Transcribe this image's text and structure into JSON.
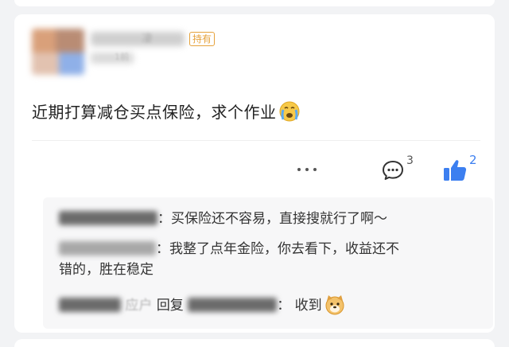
{
  "post": {
    "holding_badge": "持有",
    "text": "近期打算减仓买点保险，求个作业",
    "emoji": "crying-face",
    "username_visible_fragment": "凄",
    "subline_visible_fragment": "1前"
  },
  "actions": {
    "comment_count": "3",
    "like_count": "2"
  },
  "replies": [
    {
      "text": "：买保险还不容易，直接搜就行了啊～"
    },
    {
      "line1": "：我整了点年金险，你去看下，收益还不",
      "line2": "错的，胜在稳定"
    },
    {
      "name_fragment": "应户",
      "reply_word": "回复",
      "target_fragment": "宝宸",
      "text": "：  收到",
      "emoji": "doge"
    }
  ],
  "colors": {
    "accent": "#3c7ff0",
    "badge": "#e6a23c",
    "background": "#f2f3f5"
  }
}
